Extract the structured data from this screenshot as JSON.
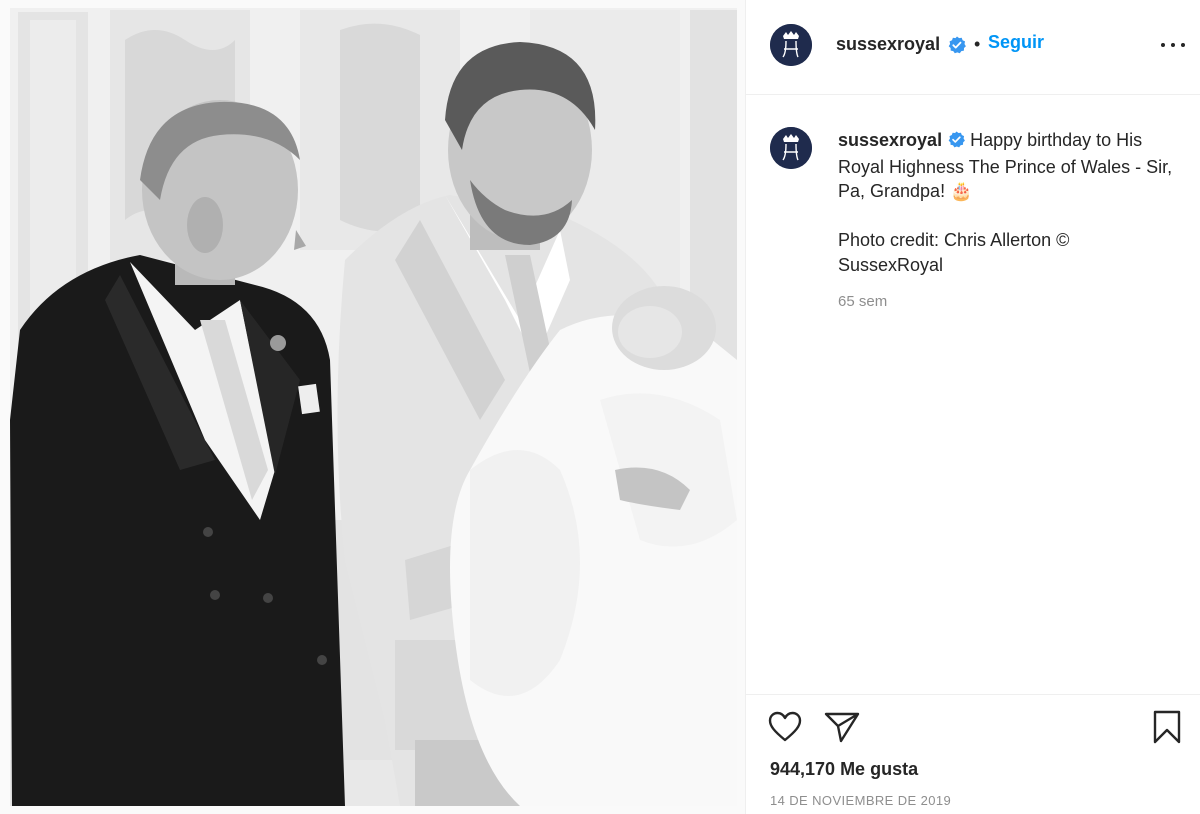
{
  "post": {
    "photo": {
      "description": "black-and-white-family-photo",
      "icon": "photo"
    }
  },
  "header": {
    "username": "sussexroyal",
    "verified_icon": "verified-badge-icon",
    "separator": "•",
    "follow_label": "Seguir",
    "more_icon": "more-options-icon"
  },
  "caption": {
    "username": "sussexroyal",
    "text": "Happy birthday to His Royal Highness The Prince of Wales - Sir, Pa, Grandpa! 🎂",
    "credit": "Photo credit: Chris Allerton © SussexRoyal",
    "time": "65 sem"
  },
  "actions": {
    "like_icon": "heart-icon",
    "share_icon": "paper-plane-icon",
    "save_icon": "bookmark-icon"
  },
  "footer": {
    "likes": "944,170 Me gusta",
    "date": "14 DE NOVIEMBRE DE 2019"
  },
  "colors": {
    "accent": "#0095f6",
    "verified": "#3897f0",
    "avatar_bg": "#1f2b4d",
    "muted": "#8e8e8e"
  }
}
